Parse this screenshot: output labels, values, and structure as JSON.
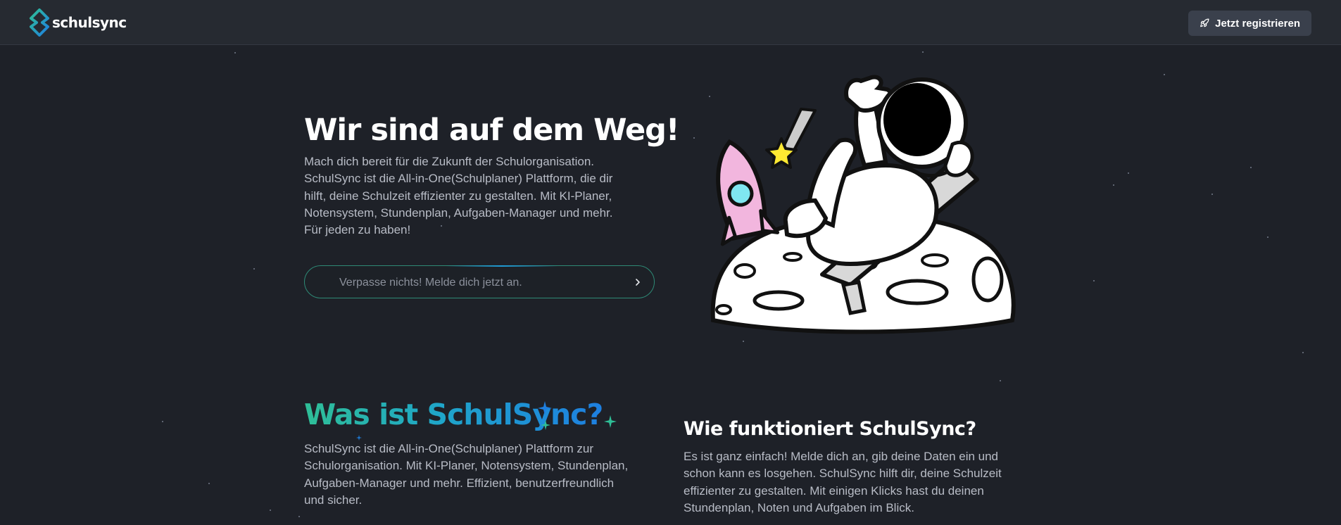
{
  "nav": {
    "logo_text": "schulsync",
    "register_label": "Jetzt registrieren"
  },
  "hero": {
    "title": "Wir sind auf dem Weg!",
    "text": "Mach dich bereit für die Zukunft der Schulorganisation. SchulSync ist die All-in-One(Schulplaner) Plattform, die dir hilft, deine Schulzeit effizienter zu gestalten. Mit KI-Planer, Notensystem, Stundenplan, Aufgaben-Manager und mehr. Für jeden zu haben!",
    "signup_placeholder": "Verpasse nichts! Melde dich jetzt an."
  },
  "what": {
    "title": "Was ist SchulSync?",
    "text": "SchulSync ist die All-in-One(Schulplaner) Plattform zur Schulorganisation. Mit KI-Planer, Notensystem, Stundenplan, Aufgaben-Manager und mehr. Effizient, benutzerfreundlich und sicher."
  },
  "how": {
    "title": "Wie funktioniert SchulSync?",
    "text": "Es ist ganz einfach! Melde dich an, gib deine Daten ein und schon kann es losgehen. SchulSync hilft dir, deine Schulzeit effizienter zu gestalten. Mit einigen Klicks hast du deinen Stundenplan, Noten und Aufgaben im Blick."
  },
  "colors": {
    "background": "#1e2128",
    "nav_background": "#262a31",
    "accent_green": "#2fbf97",
    "accent_blue": "#1e7fe0"
  },
  "icons": [
    "schulsync-logo-icon",
    "rocket-icon",
    "chevron-right-icon",
    "astronaut-illustration",
    "sparkle-icon"
  ]
}
